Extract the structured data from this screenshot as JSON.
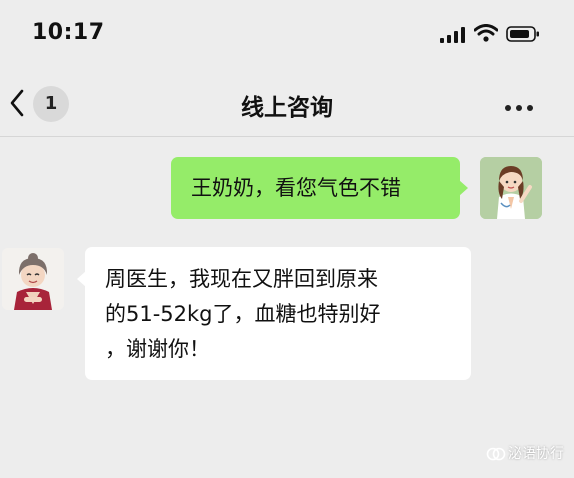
{
  "status_bar": {
    "time": "10:17"
  },
  "nav": {
    "back_count": "1",
    "title": "线上咨询",
    "more_icon": "more-dots-icon"
  },
  "messages": [
    {
      "sender": "doctor",
      "side": "right",
      "text": "王奶奶，看您气色不错"
    },
    {
      "sender": "patient",
      "side": "left",
      "lines": [
        "周医生，我现在又胖回到原来",
        "的51-52kg了，血糖也特别好",
        "，谢谢你！"
      ]
    }
  ],
  "watermark": {
    "text": "泌语协行"
  },
  "colors": {
    "sent_bubble": "#95ec69",
    "recv_bubble": "#ffffff",
    "background": "#ededed"
  }
}
